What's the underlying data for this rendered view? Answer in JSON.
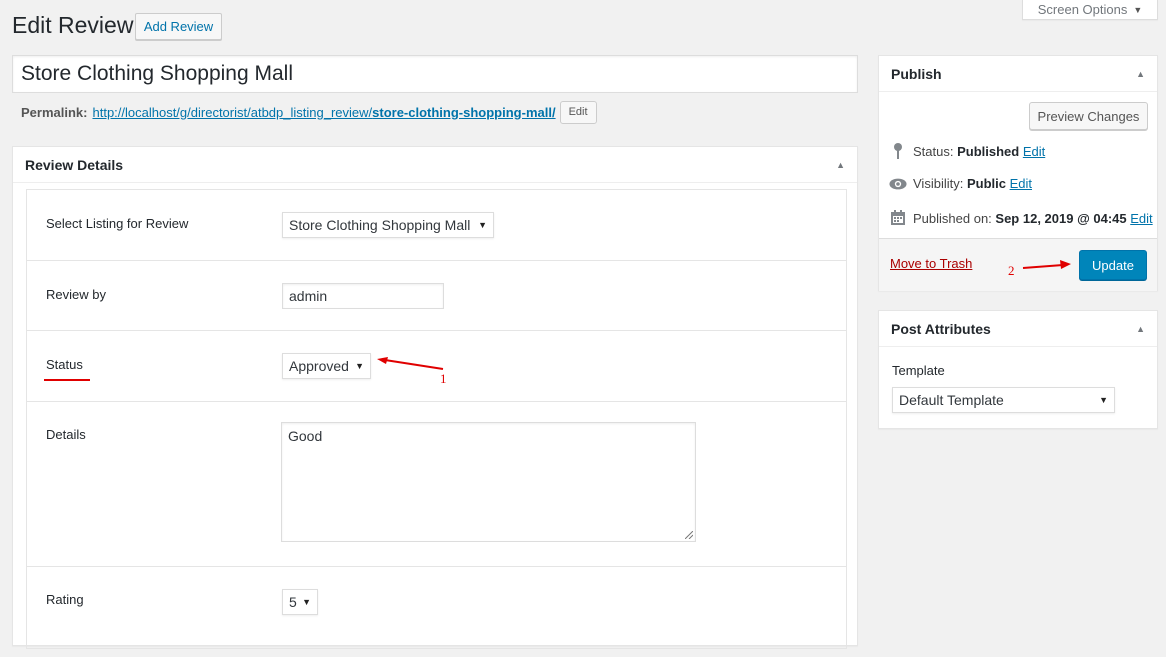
{
  "screen_options": {
    "label": "Screen Options"
  },
  "page": {
    "title": "Edit Review",
    "add_button": "Add Review"
  },
  "post_title": "Store Clothing Shopping Mall",
  "permalink": {
    "label": "Permalink:",
    "base_url": "http://localhost/g/directorist/atbdp_listing_review/",
    "slug": "store-clothing-shopping-mall/",
    "edit_label": "Edit"
  },
  "review_details": {
    "title": "Review Details",
    "fields": {
      "listing": {
        "label": "Select Listing for Review",
        "value": "Store Clothing Shopping Mall"
      },
      "review_by": {
        "label": "Review by",
        "value": "admin"
      },
      "status": {
        "label": "Status",
        "value": "Approved"
      },
      "details": {
        "label": "Details",
        "value": "Good"
      },
      "rating": {
        "label": "Rating",
        "value": "5"
      }
    }
  },
  "annotations": {
    "one": "1",
    "two": "2",
    "color": "#e00000"
  },
  "publish": {
    "title": "Publish",
    "preview_button": "Preview Changes",
    "status": {
      "label": "Status:",
      "value": "Published",
      "edit": "Edit",
      "icon": "pin-icon"
    },
    "visibility": {
      "label": "Visibility:",
      "value": "Public",
      "edit": "Edit",
      "icon": "eye-icon"
    },
    "published_on": {
      "label": "Published on:",
      "value": "Sep 12, 2019 @ 04:45",
      "edit": "Edit",
      "icon": "calendar-icon"
    },
    "trash_label": "Move to Trash",
    "update_button": "Update"
  },
  "post_attributes": {
    "title": "Post Attributes",
    "template_label": "Template",
    "template_value": "Default Template"
  },
  "colors": {
    "primary_button": "#0085ba",
    "link": "#0073aa",
    "trash": "#a00000"
  }
}
